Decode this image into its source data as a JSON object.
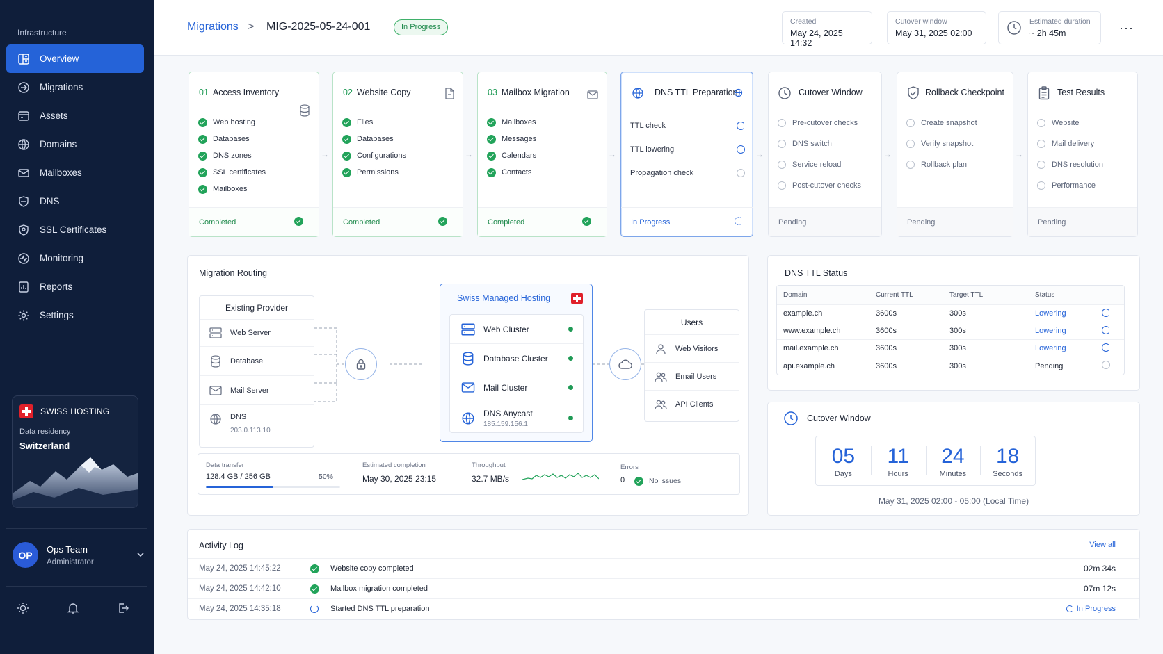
{
  "sidebar": {
    "section": "Infrastructure",
    "items": [
      {
        "label": "Overview",
        "icon": "overview-icon",
        "active": true
      },
      {
        "label": "Migrations",
        "icon": "migrations-icon"
      },
      {
        "label": "Assets",
        "icon": "assets-icon"
      },
      {
        "label": "Domains",
        "icon": "globe-icon"
      },
      {
        "label": "Mailboxes",
        "icon": "mail-icon"
      },
      {
        "label": "DNS",
        "icon": "shield-icon"
      },
      {
        "label": "SSL Certificates",
        "icon": "certificate-icon"
      },
      {
        "label": "Monitoring",
        "icon": "monitoring-icon"
      },
      {
        "label": "Reports",
        "icon": "reports-icon"
      },
      {
        "label": "Settings",
        "icon": "gear-icon"
      }
    ],
    "brand": {
      "name": "SWISS HOSTING",
      "residency_label": "Data residency",
      "country": "Switzerland"
    },
    "user": {
      "initials": "OP",
      "name": "Ops Team",
      "role": "Administrator"
    }
  },
  "header": {
    "breadcrumb_link": "Migrations",
    "breadcrumb_sep": ">",
    "migration_id": "MIG-2025-05-24-001",
    "status": "In Progress",
    "created": {
      "label": "Created",
      "value": "May 24, 2025 14:32"
    },
    "cutover": {
      "label": "Cutover window",
      "value": "May 31, 2025 02:00"
    },
    "duration": {
      "label": "Estimated duration",
      "value": "~ 2h 45m"
    },
    "more": "···"
  },
  "steps": [
    {
      "num": "01",
      "title": "Access Inventory",
      "items": [
        "Web hosting",
        "Databases",
        "DNS zones",
        "SSL certificates",
        "Mailboxes"
      ],
      "status": "Completed"
    },
    {
      "num": "02",
      "title": "Website Copy",
      "items": [
        "Files",
        "Databases",
        "Configurations",
        "Permissions"
      ],
      "status": "Completed"
    },
    {
      "num": "03",
      "title": "Mailbox Migration",
      "items": [
        "Mailboxes",
        "Messages",
        "Calendars",
        "Contacts"
      ],
      "status": "Completed"
    },
    {
      "title": "DNS TTL Preparation",
      "items": [
        "TTL check",
        "TTL lowering",
        "Propagation check"
      ],
      "status": "In Progress"
    },
    {
      "title": "Cutover Window",
      "items": [
        "Pre-cutover checks",
        "DNS switch",
        "Service reload",
        "Post-cutover checks"
      ],
      "status": "Pending"
    },
    {
      "title": "Rollback Checkpoint",
      "items": [
        "Create snapshot",
        "Verify snapshot",
        "Rollback plan"
      ],
      "status": "Pending"
    },
    {
      "title": "Test Results",
      "items": [
        "Website",
        "Mail delivery",
        "DNS resolution",
        "Performance"
      ],
      "status": "Pending"
    }
  ],
  "routing": {
    "title": "Migration Routing",
    "existing": {
      "title": "Existing Provider",
      "rows": [
        "Web Server",
        "Database",
        "Mail Server",
        "DNS"
      ],
      "dns_ip": "203.0.113.10"
    },
    "hosting": {
      "title": "Swiss Managed Hosting",
      "rows": [
        "Web Cluster",
        "Database Cluster",
        "Mail Cluster",
        "DNS Anycast"
      ],
      "anycast_ip": "185.159.156.1"
    },
    "users": {
      "title": "Users",
      "rows": [
        "Web Visitors",
        "Email Users",
        "API Clients"
      ]
    },
    "stats": {
      "transfer_label": "Data transfer",
      "transfer_value": "128.4 GB / 256 GB",
      "transfer_pct": "50%",
      "transfer_fraction": 0.5,
      "completion_label": "Estimated completion",
      "completion_value": "May 30, 2025 23:15",
      "throughput_label": "Throughput",
      "throughput_value": "32.7 MB/s",
      "errors_label": "Errors",
      "errors_value": "0",
      "errors_note": "No issues"
    }
  },
  "dns_ttl": {
    "title": "DNS TTL Status",
    "headers": [
      "Domain",
      "Current TTL",
      "Target TTL",
      "Status"
    ],
    "rows": [
      {
        "domain": "example.ch",
        "current": "3600s",
        "target": "300s",
        "status": "Lowering"
      },
      {
        "domain": "www.example.ch",
        "current": "3600s",
        "target": "300s",
        "status": "Lowering"
      },
      {
        "domain": "mail.example.ch",
        "current": "3600s",
        "target": "300s",
        "status": "Lowering"
      },
      {
        "domain": "api.example.ch",
        "current": "3600s",
        "target": "300s",
        "status": "Pending"
      }
    ]
  },
  "cutover": {
    "title": "Cutover Window",
    "days": "05",
    "days_label": "Days",
    "hours": "11",
    "hours_label": "Hours",
    "minutes": "24",
    "minutes_label": "Minutes",
    "seconds": "18",
    "seconds_label": "Seconds",
    "range": "May 31, 2025 02:00 - 05:00 (Local Time)"
  },
  "activity": {
    "title": "Activity Log",
    "view_all": "View all",
    "rows": [
      {
        "time": "May 24, 2025 14:45:22",
        "text": "Website copy completed",
        "duration": "02m 34s"
      },
      {
        "time": "May 24, 2025 14:42:10",
        "text": "Mailbox migration completed",
        "duration": "07m 12s"
      },
      {
        "time": "May 24, 2025 14:35:18",
        "text": "Started DNS TTL preparation",
        "duration": "In Progress"
      }
    ]
  },
  "colors": {
    "accent": "#2563d8",
    "success": "#22a35a",
    "sidebar": "#0f1e3a"
  }
}
